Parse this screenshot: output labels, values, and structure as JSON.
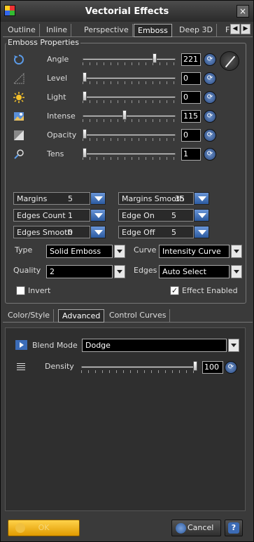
{
  "window": {
    "title": "Vectorial Effects",
    "close": "×"
  },
  "tabs_top": [
    {
      "label": "Outline"
    },
    {
      "label": "Inline"
    },
    {
      "label": "Perspective"
    },
    {
      "label": "Emboss"
    },
    {
      "label": "Deep 3D"
    },
    {
      "label": "F"
    }
  ],
  "tabs_nav": {
    "left": "◀",
    "right": "▶"
  },
  "emboss": {
    "legend": "Emboss Properties",
    "sliders": [
      {
        "label": "Angle",
        "value": "221",
        "fraction": 0.79
      },
      {
        "label": "Level",
        "value": "0",
        "fraction": 0.0
      },
      {
        "label": "Light",
        "value": "0",
        "fraction": 0.0
      },
      {
        "label": "Intense",
        "value": "115",
        "fraction": 0.45
      },
      {
        "label": "Opacity",
        "value": "0",
        "fraction": 0.0
      },
      {
        "label": "Tens",
        "value": "1",
        "fraction": 0.0
      }
    ],
    "combos": [
      {
        "label": "Margins",
        "value": "5"
      },
      {
        "label": "Margins Smooth",
        "value": "35"
      },
      {
        "label": "Edges Count",
        "value": "1"
      },
      {
        "label": "Edge On",
        "value": "5"
      },
      {
        "label": "Edges Smooth",
        "value": "0"
      },
      {
        "label": "Edge Off",
        "value": "5"
      }
    ],
    "type_label": "Type",
    "type_value": "Solid Emboss",
    "curve_label": "Curve",
    "curve_value": "Intensity Curve",
    "quality_label": "Quality",
    "quality_value": "2",
    "edges_label": "Edges",
    "edges_value": "Auto Select",
    "invert_label": "Invert",
    "invert_checked": false,
    "effect_label": "Effect Enabled",
    "effect_checked": true
  },
  "tabs_bottom": [
    {
      "label": "Color/Style"
    },
    {
      "label": "Advanced"
    },
    {
      "label": "Control Curves"
    }
  ],
  "advanced": {
    "blend_label": "Blend Mode",
    "blend_value": "Dodge",
    "density_label": "Density",
    "density_value": "100",
    "density_fraction": 1.0
  },
  "buttons": {
    "ok": "OK",
    "cancel": "Cancel",
    "help": "?"
  },
  "colors": {
    "accent_blue": "#3b6cb8",
    "ok_yellow": "#f2b620"
  }
}
